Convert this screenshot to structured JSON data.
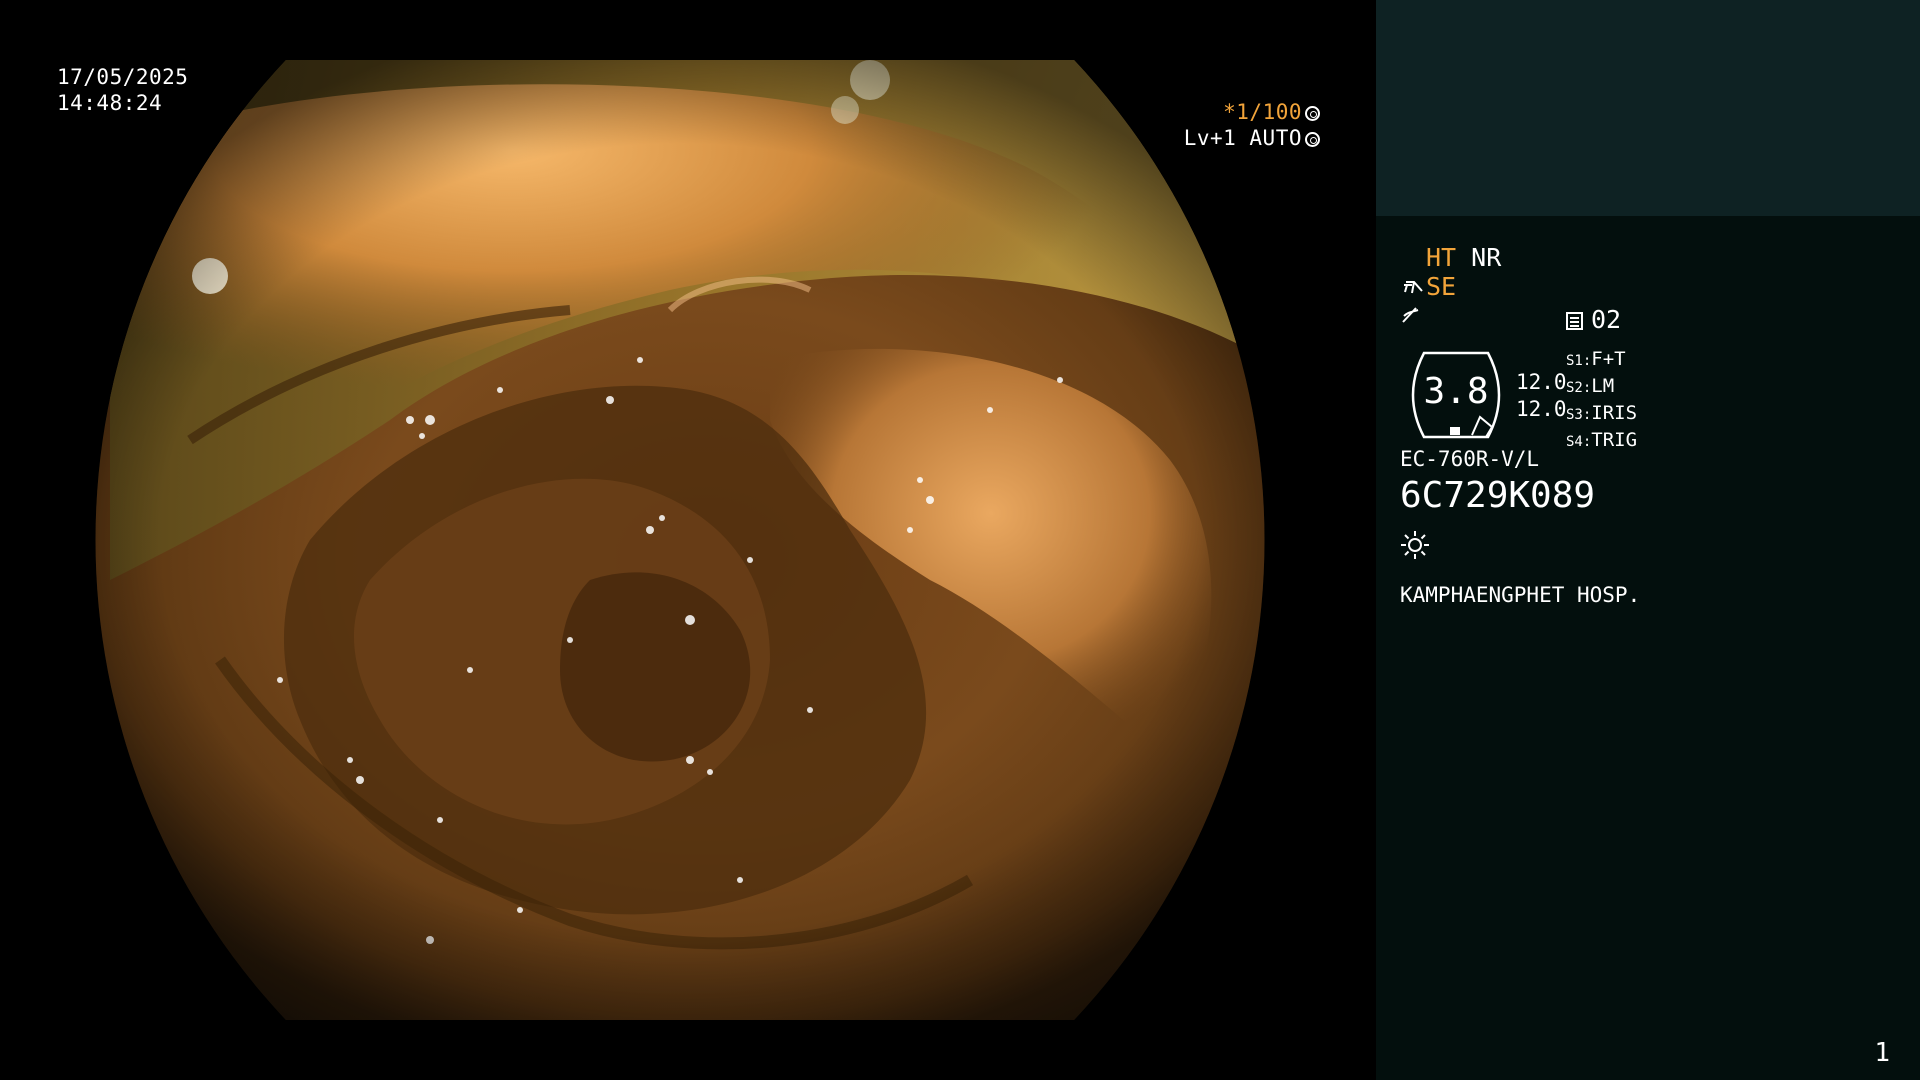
{
  "overlay": {
    "date": "17/05/2025",
    "time": "14:48:24",
    "shutter_prefix": "*1/100",
    "exposure": "Lv+1 AUTO"
  },
  "status": {
    "mode_ht": "HT",
    "mode_nr": "NR",
    "mode_se": "SE",
    "memo_count": "02",
    "zoom": "3.8",
    "param_a": "12.0",
    "param_b": "12.0",
    "switches": [
      {
        "key": "S1:",
        "value": "F+T"
      },
      {
        "key": "S2:",
        "value": "LM"
      },
      {
        "key": "S3:",
        "value": "IRIS"
      },
      {
        "key": "S4:",
        "value": "TRIG"
      }
    ],
    "scope_model": "EC-760R-V/L",
    "serial": "6C729K089",
    "hospital": "KAMPHAENGPHET HOSP.",
    "page_number": "1"
  },
  "icons": {
    "camera": "camera-icon",
    "memo": "memo-icon",
    "light": "sun-icon",
    "zoom_gauge": "zoom-gauge-icon"
  },
  "colors": {
    "accent_orange": "#f2a43a",
    "panel_top": "#0e2223",
    "panel_bottom": "#030f0d"
  }
}
